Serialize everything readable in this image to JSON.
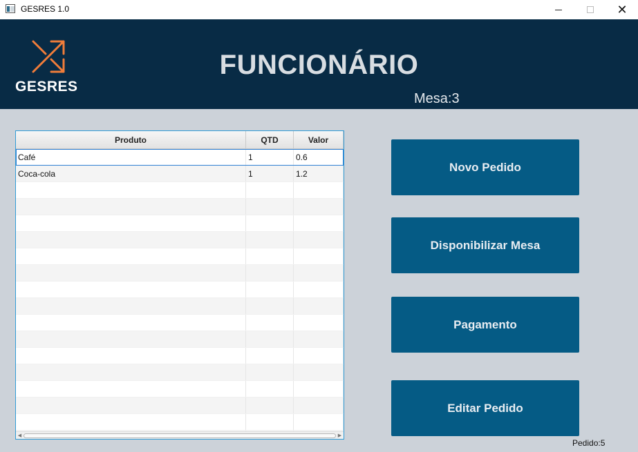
{
  "window": {
    "title": "GESRES 1.0",
    "icon": "app-window-icon",
    "controls": {
      "minimize": "minimize-icon",
      "maximize": "maximize-icon",
      "close_glyph": "✕"
    }
  },
  "header": {
    "logo_text": "GESRES",
    "logo_icon": "arrows-shuffle-icon",
    "title": "FUNCIONÁRIO",
    "mesa": "Mesa:3"
  },
  "table": {
    "columns": [
      "Produto",
      "QTD",
      "Valor"
    ],
    "rows": [
      [
        "Café",
        "1",
        "0.6"
      ],
      [
        "Coca-cola",
        "1",
        "1.2"
      ]
    ],
    "empty_rows": 16
  },
  "buttons": {
    "novo_pedido": "Novo Pedido",
    "disponibilizar_mesa": "Disponibilizar Mesa",
    "pagamento": "Pagamento",
    "editar_pedido": "Editar Pedido"
  },
  "status": {
    "pedido": "Pedido:5"
  },
  "colors": {
    "header_bg": "#082b45",
    "accent_orange": "#f07d3a",
    "button_bg": "#055b85",
    "page_bg": "#ccd2d9"
  }
}
